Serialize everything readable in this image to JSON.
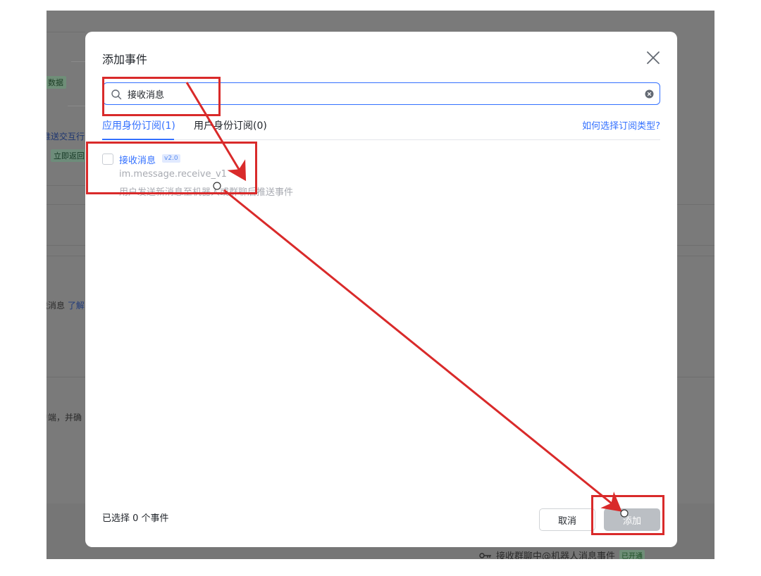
{
  "background": {
    "fragments": {
      "data": "数据",
      "push_interactive": "推送交互行",
      "return_now": "立即返回",
      "message_learn": "送消息",
      "learn_more": "了解",
      "client_end": "户端，并确"
    },
    "footer": {
      "event_name": "接收群聊中@机器人消息事件",
      "status": "已开通"
    }
  },
  "modal": {
    "title": "添加事件",
    "search": {
      "value": "接收消息",
      "placeholder": ""
    },
    "tabs": [
      {
        "label": "应用身份订阅(1)",
        "active": true
      },
      {
        "label": "用户身份订阅(0)",
        "active": false
      }
    ],
    "help_link": "如何选择订阅类型?",
    "events": [
      {
        "name": "接收消息",
        "version": "v2.0",
        "key": "im.message.receive_v1",
        "description": "用户发送新消息至机器人或群聊后推送事件",
        "checked": false
      }
    ],
    "selected_count": "已选择 0 个事件",
    "cancel_label": "取消",
    "add_label": "添加"
  },
  "colors": {
    "accent": "#3370ff",
    "annotation": "#d92a2a",
    "overlay": "#7a7a7a"
  }
}
